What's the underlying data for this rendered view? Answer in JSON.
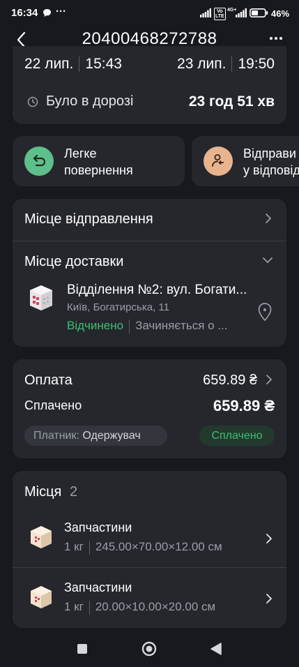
{
  "status_bar": {
    "time": "16:34",
    "battery": "46%"
  },
  "header": {
    "title": "20400468272788",
    "back_icon": "chevron-left-icon",
    "menu_icon": "more-dots-icon"
  },
  "trip": {
    "depart_date": "22 лип.",
    "depart_time": "15:43",
    "arrive_date": "23 лип.",
    "arrive_time": "19:50",
    "duration_label": "Було в дорозі",
    "duration_value": "23 год 51 хв"
  },
  "actions": [
    {
      "label_line1": "Легке",
      "label_line2": "повернення",
      "icon": "return-arrow-icon",
      "color": "#5fbf8a"
    },
    {
      "label_line1": "Відправи",
      "label_line2": "у відповід",
      "icon": "person-arrow-icon",
      "color": "#e8b48e"
    }
  ],
  "route": {
    "origin_label": "Місце відправлення",
    "destination_label": "Місце доставки",
    "branch_name": "Відділення №2: вул. Богати...",
    "branch_address": "Київ, Богатирська, 11",
    "status_open": "Відчинено",
    "closes_text": "Зачиняється о ...",
    "open_color": "#3fbf73"
  },
  "payment": {
    "label": "Оплата",
    "amount": "659.89 ₴",
    "paid_label": "Сплачено",
    "paid_amount": "659.89 ₴",
    "payer_label": "Платник:",
    "payer_value": "Одержувач",
    "paid_badge": "Сплачено"
  },
  "places": {
    "title": "Місця",
    "count": "2",
    "items": [
      {
        "name": "Запчастини",
        "weight": "1 кг",
        "dims": "245.00×70.00×12.00 см"
      },
      {
        "name": "Запчастини",
        "weight": "1 кг",
        "dims": "20.00×10.00×20.00 см"
      }
    ]
  }
}
